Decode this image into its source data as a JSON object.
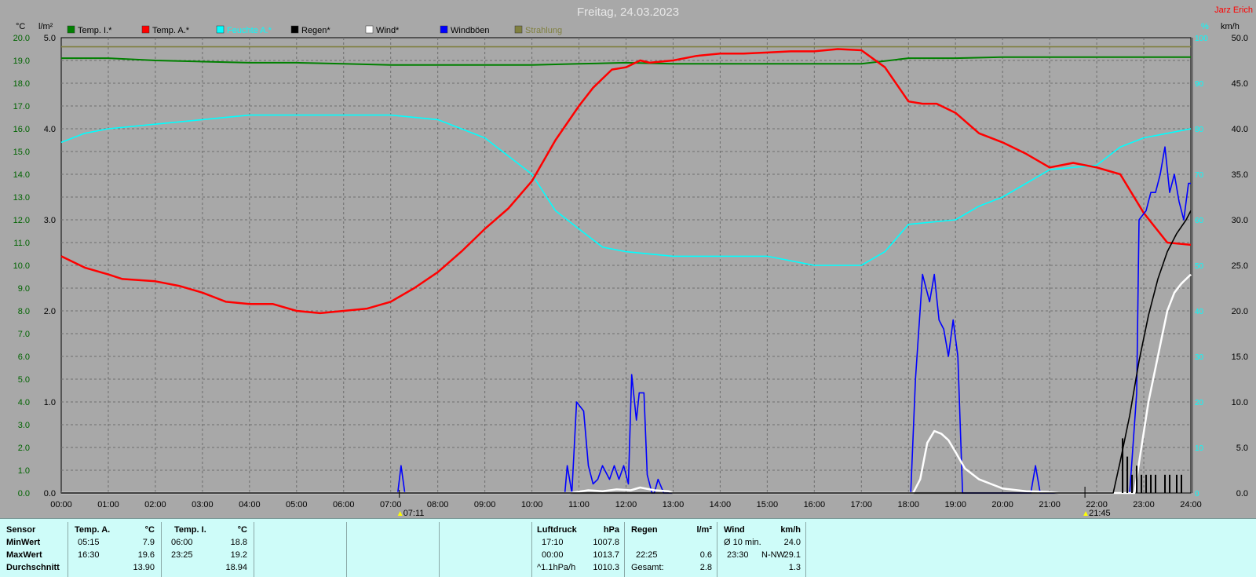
{
  "header": {
    "title": "Freitag, 24.03.2023",
    "author": "Jarz Erich"
  },
  "units": {
    "left_temp": "°C",
    "left_rain": "l/m²",
    "right_percent": "%",
    "right_wind": "km/h"
  },
  "legend": [
    {
      "label": "Temp. I.*",
      "color": "#008000"
    },
    {
      "label": "Temp. A.*",
      "color": "#ff0000"
    },
    {
      "label": "Feuchte A.*",
      "color": "#00ffff"
    },
    {
      "label": "Regen*",
      "color": "#000000"
    },
    {
      "label": "Wind*",
      "color": "#ffffff"
    },
    {
      "label": "Windböen",
      "color": "#0000ff"
    },
    {
      "label": "Strahlung",
      "color": "#808040"
    }
  ],
  "chart_data": {
    "type": "line",
    "title": "Freitag, 24.03.2023",
    "x_ticks": [
      "00:00",
      "01:00",
      "02:00",
      "03:00",
      "04:00",
      "05:00",
      "06:00",
      "07:00",
      "08:00",
      "09:00",
      "10:00",
      "11:00",
      "12:00",
      "13:00",
      "14:00",
      "15:00",
      "16:00",
      "17:00",
      "18:00",
      "19:00",
      "20:00",
      "21:00",
      "22:00",
      "23:00",
      "24:00"
    ],
    "sunrise_label": "07:11",
    "sunset_label": "21:45",
    "axes": {
      "temp": {
        "ylim": [
          0,
          20
        ],
        "ticks": [
          "0.0",
          "1.0",
          "2.0",
          "3.0",
          "4.0",
          "5.0",
          "6.0",
          "7.0",
          "8.0",
          "9.0",
          "10.0",
          "11.0",
          "12.0",
          "13.0",
          "14.0",
          "15.0",
          "16.0",
          "17.0",
          "18.0",
          "19.0",
          "20.0"
        ]
      },
      "rain": {
        "ylim": [
          0,
          5
        ],
        "ticks": [
          "0.0",
          "1.0",
          "2.0",
          "3.0",
          "4.0",
          "5.0"
        ]
      },
      "humidity": {
        "ylim": [
          0,
          100
        ],
        "ticks": [
          "0",
          "10",
          "20",
          "30",
          "40",
          "50",
          "60",
          "70",
          "80",
          "90",
          "100"
        ]
      },
      "wind": {
        "ylim": [
          0,
          50
        ],
        "ticks": [
          "0.0",
          "5.0",
          "10.0",
          "15.0",
          "20.0",
          "25.0",
          "30.0",
          "35.0",
          "40.0",
          "45.0",
          "50.0"
        ]
      }
    },
    "grid": true,
    "series": [
      {
        "name": "Temp. I.*",
        "axis": "temp",
        "color": "#008000",
        "x": [
          0,
          1,
          2,
          3,
          4,
          5,
          6,
          7,
          8,
          9,
          10,
          11,
          12,
          13,
          14,
          15,
          16,
          17,
          18,
          19,
          20,
          21,
          22,
          23,
          24
        ],
        "y": [
          19.1,
          19.1,
          19.0,
          18.95,
          18.9,
          18.9,
          18.85,
          18.8,
          18.8,
          18.8,
          18.8,
          18.85,
          18.9,
          18.85,
          18.85,
          18.85,
          18.85,
          18.85,
          19.1,
          19.1,
          19.15,
          19.15,
          19.15,
          19.15,
          19.15
        ]
      },
      {
        "name": "Temp. A.*",
        "axis": "temp",
        "color": "#ff0000",
        "x": [
          0,
          0.5,
          1,
          1.3,
          2,
          2.5,
          3,
          3.5,
          4,
          4.5,
          5,
          5.5,
          6,
          6.5,
          7,
          7.5,
          8,
          8.5,
          9,
          9.5,
          10,
          10.5,
          11,
          11.3,
          11.7,
          12,
          12.3,
          12.5,
          13,
          13.5,
          14,
          14.5,
          15,
          15.5,
          16,
          16.5,
          17,
          17.5,
          18,
          18.3,
          18.6,
          19,
          19.5,
          20,
          20.5,
          21,
          21.5,
          22,
          22.5,
          23,
          23.5,
          24
        ],
        "y": [
          10.4,
          9.9,
          9.6,
          9.4,
          9.3,
          9.1,
          8.8,
          8.4,
          8.3,
          8.3,
          8.0,
          7.9,
          8.0,
          8.1,
          8.4,
          9.0,
          9.7,
          10.6,
          11.6,
          12.5,
          13.7,
          15.5,
          17.0,
          17.8,
          18.6,
          18.7,
          19.0,
          18.9,
          19.0,
          19.2,
          19.3,
          19.3,
          19.35,
          19.4,
          19.4,
          19.5,
          19.45,
          18.7,
          17.2,
          17.1,
          17.1,
          16.7,
          15.8,
          15.4,
          14.9,
          14.3,
          14.5,
          14.3,
          14.0,
          12.3,
          11.0,
          10.9
        ]
      },
      {
        "name": "Feuchte A.*",
        "axis": "humidity",
        "color": "#00ffff",
        "x": [
          0,
          0.5,
          1,
          2,
          3,
          4,
          5,
          6,
          7,
          8,
          8.5,
          9,
          9.5,
          10,
          10.5,
          11,
          11.5,
          12,
          13,
          14,
          15,
          16,
          17,
          17.5,
          18,
          19,
          19.5,
          20,
          21,
          22,
          22.5,
          23,
          23.5,
          24
        ],
        "y": [
          77,
          79,
          80,
          81,
          82,
          83,
          83,
          83,
          83,
          82,
          80,
          78,
          74,
          70,
          62,
          58,
          54,
          53,
          52,
          52,
          52,
          50,
          50,
          53,
          59,
          60,
          63,
          65,
          71,
          72,
          76,
          78,
          79,
          80
        ]
      },
      {
        "name": "Regen*",
        "axis": "rain",
        "color": "#000000",
        "x": [
          0,
          22.35,
          22.5,
          22.7,
          22.9,
          23.1,
          23.3,
          23.5,
          23.7,
          23.9,
          24
        ],
        "y": [
          0,
          0,
          0.35,
          0.85,
          1.45,
          1.95,
          2.35,
          2.65,
          2.85,
          3.0,
          3.1
        ]
      },
      {
        "name": "Wind*",
        "axis": "wind",
        "color": "#ffffff",
        "x": [
          0,
          10.8,
          11.2,
          11.5,
          11.8,
          12.1,
          12.3,
          12.6,
          12.9,
          13.0,
          18.1,
          18.25,
          18.4,
          18.55,
          18.7,
          18.85,
          19.0,
          19.2,
          19.5,
          20.0,
          20.5,
          21.0,
          21.2,
          22.8,
          22.95,
          23.1,
          23.3,
          23.5,
          23.65,
          23.8,
          23.9,
          24
        ],
        "y": [
          0,
          0,
          0.3,
          0.2,
          0.4,
          0.3,
          0.6,
          0.3,
          0.2,
          0,
          0,
          1.5,
          5.5,
          6.8,
          6.5,
          5.8,
          4.5,
          2.7,
          1.5,
          0.5,
          0.2,
          0.1,
          0,
          0,
          5,
          10,
          15,
          20,
          22,
          23,
          23.5,
          24
        ]
      },
      {
        "name": "Windböen",
        "axis": "wind",
        "color": "#0000ff",
        "x": [
          0,
          7.15,
          7.22,
          7.3,
          10.7,
          10.75,
          10.85,
          10.95,
          11.1,
          11.2,
          11.3,
          11.4,
          11.5,
          11.65,
          11.75,
          11.85,
          11.95,
          12.05,
          12.12,
          12.22,
          12.28,
          12.38,
          12.45,
          12.55,
          12.6,
          12.68,
          12.8,
          12.9,
          13.0,
          17.9,
          18.05,
          18.15,
          18.3,
          18.45,
          18.55,
          18.65,
          18.75,
          18.85,
          18.95,
          19.05,
          19.15,
          19.25,
          20.6,
          20.7,
          20.8,
          22.6,
          22.7,
          22.85,
          22.9,
          23.05,
          23.15,
          23.25,
          23.35,
          23.45,
          23.55,
          23.65,
          23.75,
          23.85,
          23.95,
          24
        ],
        "y": [
          0,
          0,
          3,
          0,
          0,
          3,
          0,
          10,
          9,
          3,
          1,
          1.5,
          3,
          1.5,
          3,
          1.5,
          3,
          1,
          13,
          8,
          11,
          11,
          2,
          0,
          0,
          1.5,
          0,
          0,
          0,
          0,
          0,
          12.5,
          24,
          21,
          24,
          19,
          18,
          15,
          19,
          15,
          0,
          0,
          0,
          3,
          0,
          0,
          0,
          11,
          30,
          31,
          33,
          33,
          35,
          38,
          33,
          35,
          32,
          30,
          34,
          34
        ]
      },
      {
        "name": "Strahlung",
        "axis": "humidity",
        "color": "#808040",
        "x": [
          0,
          24
        ],
        "y": [
          98,
          98
        ]
      }
    ],
    "rain_bars": {
      "x": [
        22.55,
        22.65,
        22.75,
        22.85,
        22.95,
        23.05,
        23.15,
        23.25,
        23.45,
        23.55,
        23.7,
        23.8
      ],
      "y": [
        0.6,
        0.4,
        0.2,
        0.3,
        0.2,
        0.2,
        0.2,
        0.2,
        0.2,
        0.2,
        0.2,
        0.2
      ]
    }
  },
  "table": {
    "sensor": {
      "header": "Sensor",
      "rows": [
        "MinWert",
        "MaxWert",
        "Durchschnitt"
      ]
    },
    "temp_a": {
      "title": "Temp. A.",
      "unit": "°C",
      "min_time": "05:15",
      "min_val": "7.9",
      "max_time": "16:30",
      "max_val": "19.6",
      "avg": "13.90"
    },
    "temp_i": {
      "title": "Temp. I.",
      "unit": "°C",
      "min_time": "06:00",
      "min_val": "18.8",
      "max_time": "23:25",
      "max_val": "19.2",
      "avg": "18.94"
    },
    "luftdruck": {
      "title": "Luftdruck",
      "unit": "hPa",
      "min_time": "17:10",
      "min_val": "1007.8",
      "max_time": "00:00",
      "max_val": "1013.7",
      "trend_label": "^1.1hPa/h",
      "avg": "1010.3"
    },
    "regen": {
      "title": "Regen",
      "unit": "l/m²",
      "max_time": "22:25",
      "max_val": "0.6",
      "total_label": "Gesamt:",
      "total": "2.8"
    },
    "wind": {
      "title": "Wind",
      "unit": "km/h",
      "label10": "Ø 10 min.",
      "val10": "24.0",
      "max_time": "23:30",
      "max_dir": "N-NW",
      "max_val": "29.1",
      "avg": "1.3"
    }
  }
}
